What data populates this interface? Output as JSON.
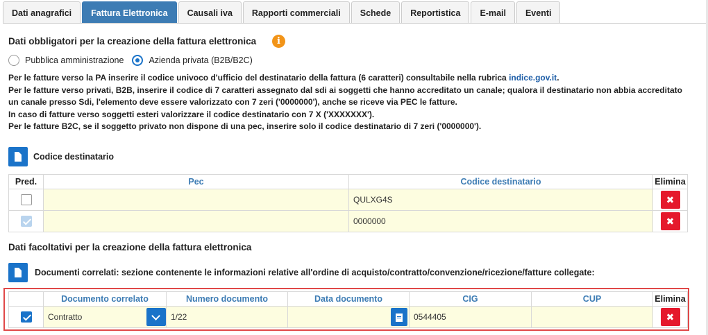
{
  "tabs": [
    {
      "label": "Dati anagrafici",
      "active": false
    },
    {
      "label": "Fattura Elettronica",
      "active": true
    },
    {
      "label": "Causali iva",
      "active": false
    },
    {
      "label": "Rapporti commerciali",
      "active": false
    },
    {
      "label": "Schede",
      "active": false
    },
    {
      "label": "Reportistica",
      "active": false
    },
    {
      "label": "E-mail",
      "active": false
    },
    {
      "label": "Eventi",
      "active": false
    }
  ],
  "mandatory": {
    "title": "Dati obbligatori per la creazione della fattura elettronica",
    "info_icon": "i",
    "radio_options": [
      {
        "label": "Pubblica amministrazione",
        "selected": false
      },
      {
        "label": "Azienda privata (B2B/B2C)",
        "selected": true
      }
    ],
    "info_lines": {
      "line1_prefix": "Per le fatture verso la PA inserire il codice univoco d'ufficio del destinatario della fattura (6 caratteri) consultabile nella rubrica ",
      "line1_link": "indice.gov.it",
      "line1_suffix": ".",
      "line2": "Per le fatture verso privati, B2B, inserire il codice di 7 caratteri assegnato dal sdi ai soggetti che hanno accreditato un canale; qualora il destinatario non abbia accreditato un canale presso Sdi, l'elemento deve essere valorizzato con 7 zeri ('0000000'), anche se riceve via PEC le fatture.",
      "line3": "In caso di fatture verso soggetti esteri valorizzare il codice destinatario con 7 X ('XXXXXXX').",
      "line4": "Per le fatture B2C, se il soggetto privato non dispone di una pec, inserire solo il codice destinatario di 7 zeri ('0000000')."
    }
  },
  "codice_section": {
    "label": "Codice destinatario",
    "columns": {
      "pred": "Pred.",
      "pec": "Pec",
      "codice": "Codice destinatario",
      "elimina": "Elimina"
    },
    "rows": [
      {
        "pred": false,
        "pred_state": "unchecked",
        "pec": "",
        "codice": "QULXG4S"
      },
      {
        "pred": true,
        "pred_state": "checked-disabled",
        "pec": "",
        "codice": "0000000"
      }
    ]
  },
  "optional": {
    "title": "Dati facoltativi per la creazione della fattura elettronica",
    "doc_label": "Documenti correlati: sezione contenente le informazioni relative all'ordine di acquisto/contratto/convenzione/ricezione/fatture collegate:",
    "columns": {
      "documento": "Documento correlato",
      "numero": "Numero documento",
      "data": "Data documento",
      "cig": "CIG",
      "cup": "CUP",
      "elimina": "Elimina"
    },
    "rows": [
      {
        "checked": true,
        "documento": "Contratto",
        "numero": "1/22",
        "data": "",
        "cig": "0544405",
        "cup": ""
      }
    ]
  },
  "icons": {
    "delete": "✖",
    "doc": "document-icon",
    "calendar": "calendar-icon",
    "dropdown": "chevron-down-icon"
  },
  "colors": {
    "accent": "#1a73c9",
    "active_tab": "#3d7cb4",
    "delete": "#e5192c",
    "info": "#f29418",
    "field_bg": "#fdfde0",
    "select_bg": "#c9f5c9"
  }
}
